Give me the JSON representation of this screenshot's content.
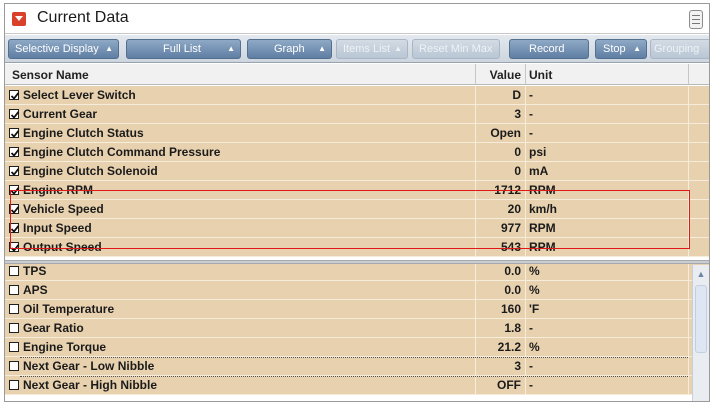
{
  "window": {
    "title": "Current Data"
  },
  "toolbar": {
    "buttons": [
      {
        "label": "Selective Display",
        "enabled": true
      },
      {
        "label": "Full List",
        "enabled": true
      },
      {
        "label": "Graph",
        "enabled": true
      },
      {
        "label": "Items List",
        "enabled": false
      },
      {
        "label": "Reset Min Max",
        "enabled": false
      },
      {
        "label": "Record",
        "enabled": true
      },
      {
        "label": "Stop",
        "enabled": true
      },
      {
        "label": "Grouping",
        "enabled": false
      }
    ]
  },
  "table": {
    "headers": {
      "name": "Sensor Name",
      "value": "Value",
      "unit": "Unit"
    },
    "rows": [
      {
        "name": "Select Lever Switch",
        "value": "D",
        "unit": "-",
        "checked": true
      },
      {
        "name": "Current Gear",
        "value": "3",
        "unit": "-",
        "checked": true
      },
      {
        "name": "Engine Clutch Status",
        "value": "Open",
        "unit": "-",
        "checked": true
      },
      {
        "name": "Engine Clutch Command Pressure",
        "value": "0",
        "unit": "psi",
        "checked": true
      },
      {
        "name": "Engine Clutch Solenoid",
        "value": "0",
        "unit": "mA",
        "checked": true
      },
      {
        "name": "Engine RPM",
        "value": "1712",
        "unit": "RPM",
        "checked": true
      },
      {
        "name": "Vehicle Speed",
        "value": "20",
        "unit": "km/h",
        "checked": true
      },
      {
        "name": "Input Speed",
        "value": "977",
        "unit": "RPM",
        "checked": true
      },
      {
        "name": "Output Speed",
        "value": "543",
        "unit": "RPM",
        "checked": true
      },
      {
        "name": "TPS",
        "value": "0.0",
        "unit": "%",
        "checked": false
      },
      {
        "name": "APS",
        "value": "0.0",
        "unit": "%",
        "checked": false
      },
      {
        "name": "Oil Temperature",
        "value": "160",
        "unit": "'F",
        "checked": false
      },
      {
        "name": "Gear Ratio",
        "value": "1.8",
        "unit": "-",
        "checked": false
      },
      {
        "name": "Engine Torque",
        "value": "21.2",
        "unit": "%",
        "checked": false
      },
      {
        "name": "Next Gear - Low Nibble",
        "value": "3",
        "unit": "-",
        "checked": false
      },
      {
        "name": "Next Gear - High Nibble",
        "value": "OFF",
        "unit": "-",
        "checked": false
      }
    ]
  },
  "colors": {
    "row_background": "#e7d1ae",
    "highlight_border": "#e01818",
    "title_icon": "#d9412a",
    "toolbar_button": "#6f8db0"
  },
  "icons": {
    "title": "collapse-arrow-icon",
    "menu": "list-menu-icon",
    "dropdown": "up-down-arrows-icon",
    "checkbox_checked": "check-icon"
  }
}
